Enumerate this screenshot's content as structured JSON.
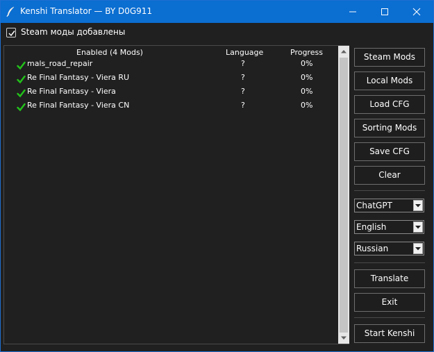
{
  "window": {
    "title": "Kenshi Translator — BY D0G911"
  },
  "checkbox": {
    "label": "Steam моды добавлены",
    "checked": true
  },
  "table": {
    "headers": {
      "name": "Enabled (4 Mods)",
      "language": "Language",
      "progress": "Progress"
    },
    "rows": [
      {
        "name": "mals_road_repair",
        "language": "?",
        "progress": "0%"
      },
      {
        "name": "Re Final Fantasy - Viera RU",
        "language": "?",
        "progress": "0%"
      },
      {
        "name": "Re Final Fantasy - Viera",
        "language": "?",
        "progress": "0%"
      },
      {
        "name": "Re Final Fantasy - Viera CN",
        "language": "?",
        "progress": "0%"
      }
    ]
  },
  "buttons": {
    "steam_mods": "Steam Mods",
    "local_mods": "Local Mods",
    "load_cfg": "Load CFG",
    "sorting_mods": "Sorting Mods",
    "save_cfg": "Save CFG",
    "clear": "Clear",
    "translate": "Translate",
    "exit": "Exit",
    "start_kenshi": "Start Kenshi"
  },
  "selects": {
    "engine": "ChatGPT",
    "source_language": "English",
    "target_language": "Russian"
  },
  "colors": {
    "titlebar": "#0b6ed1",
    "background": "#202020",
    "check_green": "#22c31a"
  },
  "icons": {
    "app": "quill-icon",
    "row_status": "green-check-icon"
  }
}
